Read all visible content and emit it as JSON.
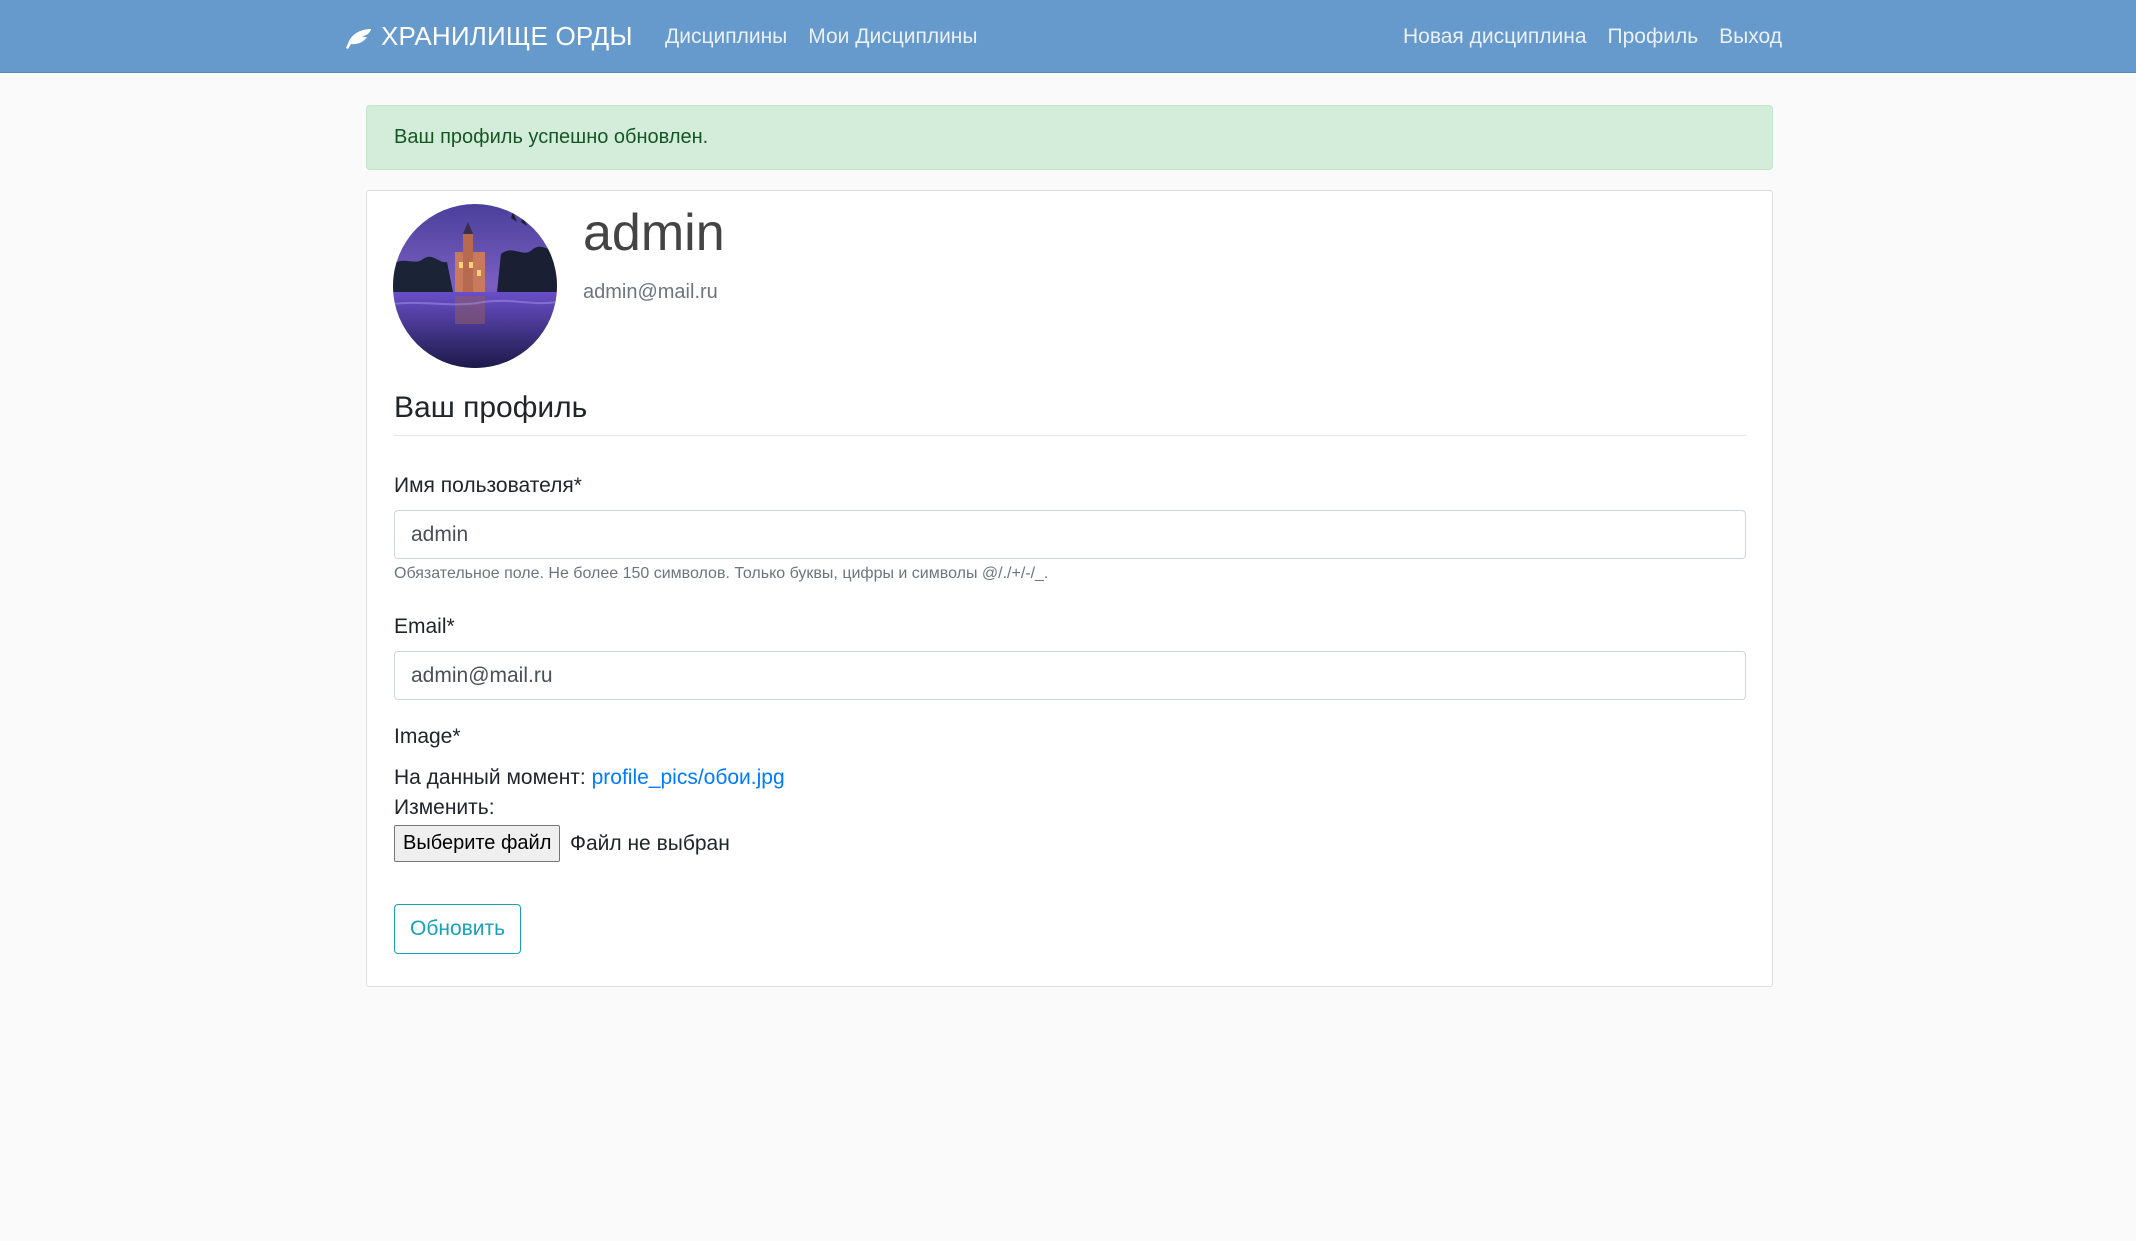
{
  "navbar": {
    "brand_icon": "feather-icon",
    "brand": "ХРАНИЛИЩЕ ОРДЫ",
    "left_links": [
      "Дисциплины",
      "Мои Дисциплины"
    ],
    "right_links": [
      "Новая дисциплина",
      "Профиль",
      "Выход"
    ]
  },
  "alert": {
    "message": "Ваш профиль успешно обновлен."
  },
  "profile": {
    "avatar": "avatar-image",
    "username": "admin",
    "email": "admin@mail.ru"
  },
  "form": {
    "title": "Ваш профиль",
    "username_label": "Имя пользователя*",
    "username_value": "admin",
    "username_help": "Обязательное поле. Не более 150 символов. Только буквы, цифры и символы @/./+/-/_.",
    "email_label": "Email*",
    "email_value": "admin@mail.ru",
    "image_label": "Image*",
    "current_prefix": "На данный момент:",
    "current_file": "profile_pics/обои.jpg",
    "change_label": "Изменить:",
    "file_button": "Выберите файл",
    "file_status": "Файл не выбран",
    "submit": "Обновить"
  },
  "colors": {
    "navbar": "#6699cc",
    "alert_bg": "#d4edda",
    "alert_text": "#155724",
    "link": "#007bff",
    "submit": "#17a2b8"
  }
}
